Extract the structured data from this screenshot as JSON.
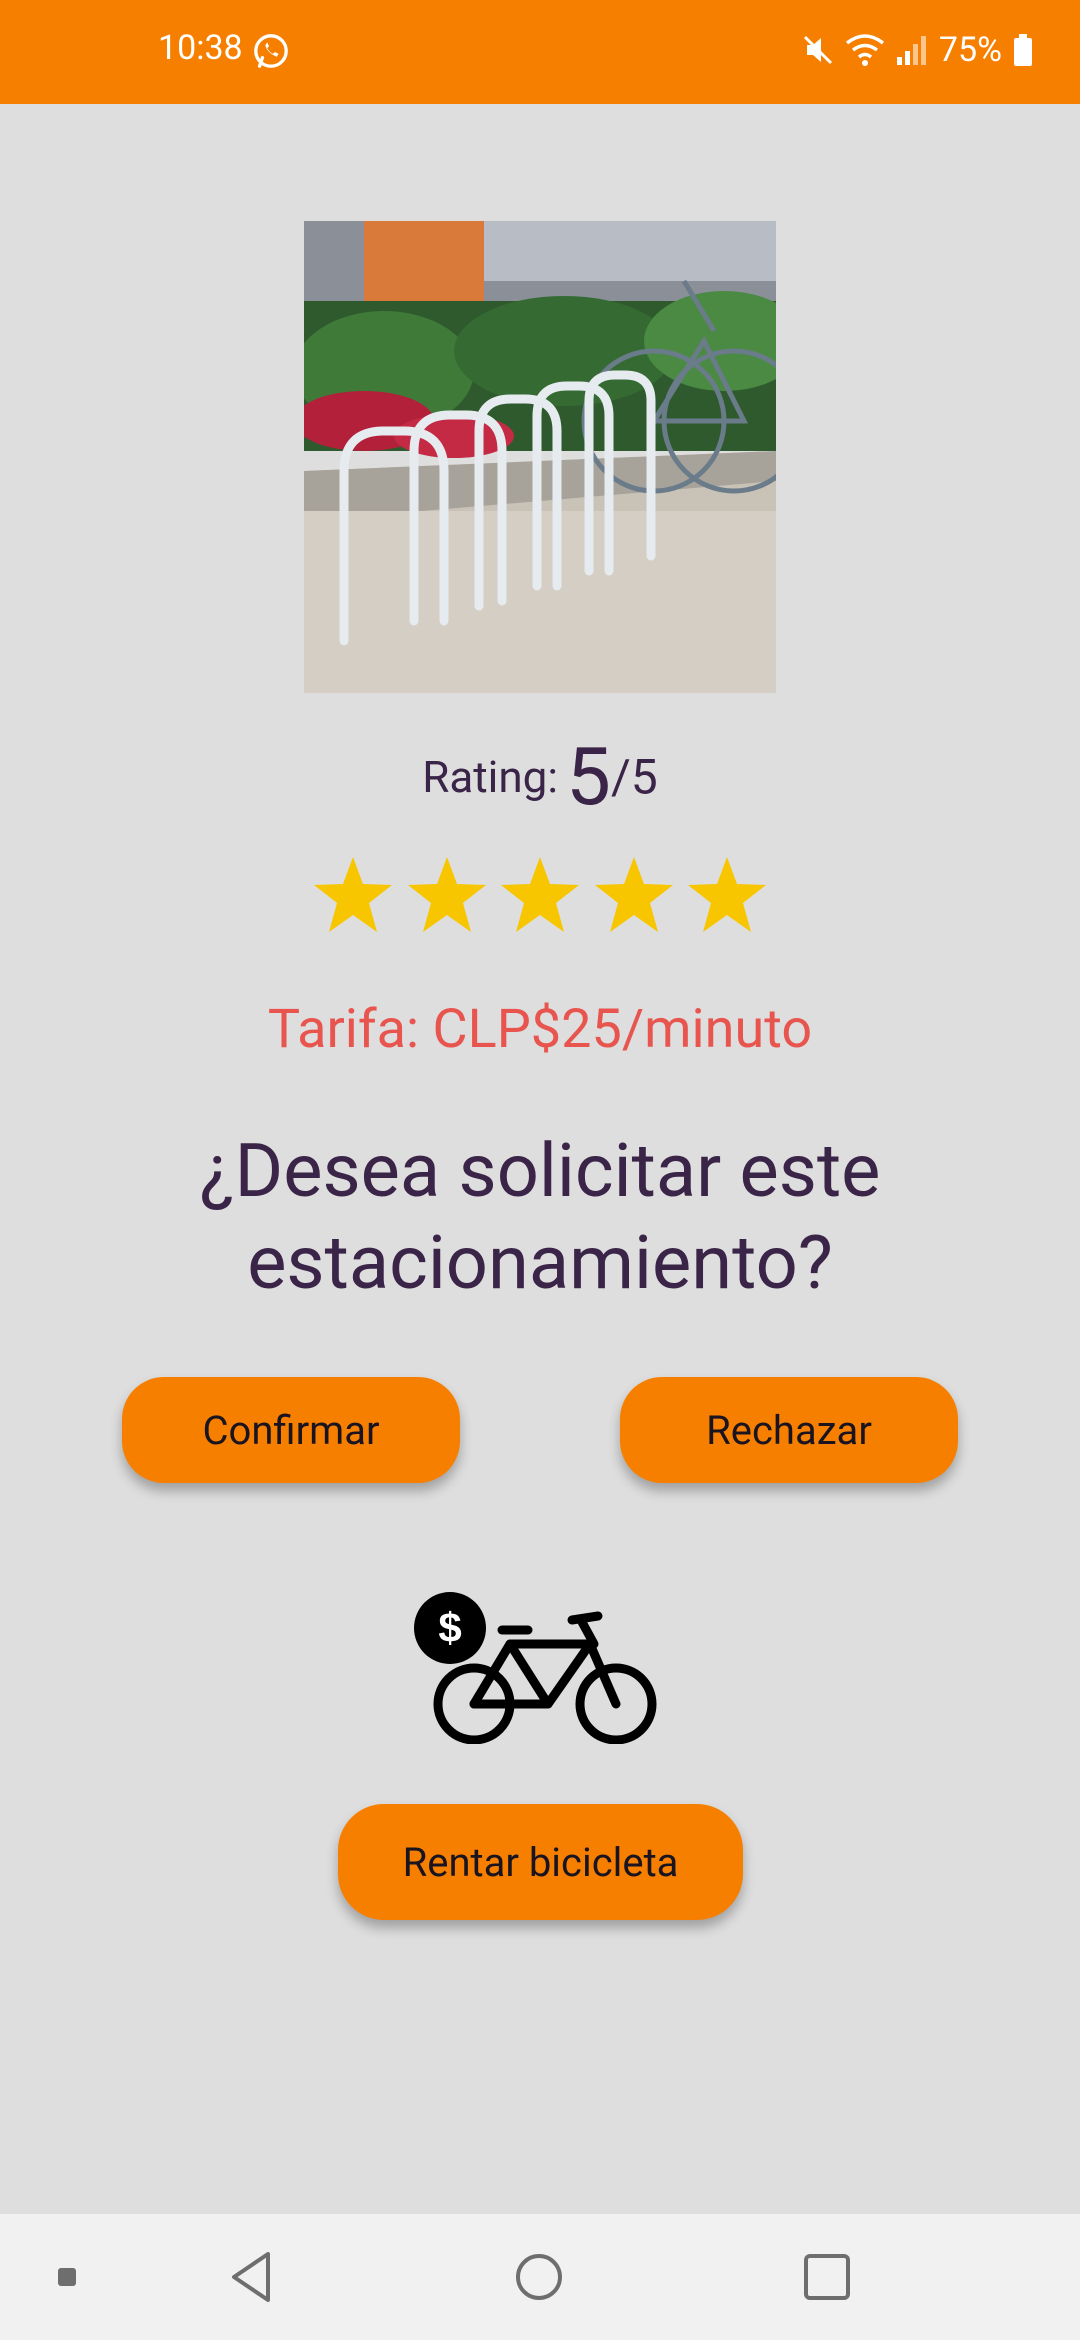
{
  "status_bar": {
    "time": "10:38",
    "battery": "75%",
    "icons": [
      "whatsapp-icon",
      "mute-icon",
      "wifi-icon",
      "signal-icon",
      "battery-icon"
    ]
  },
  "colors": {
    "accent": "#f77f00",
    "price": "#e8554e",
    "text": "#3a2447",
    "star": "#f7c600",
    "background": "#dedede"
  },
  "parking": {
    "image_icon": "bicycle-rack-photo",
    "rating_label": "Rating:",
    "rating_value": "5",
    "rating_max": "/5",
    "stars_filled": 5,
    "stars_total": 5,
    "tarifa": "Tarifa: CLP$25/minuto",
    "question": "¿Desea solicitar este estacionamiento?"
  },
  "actions": {
    "confirm_label": "Confirmar",
    "reject_label": "Rechazar",
    "rent_icon": "bike-rental-icon",
    "rent_label": "Rentar bicicleta"
  },
  "nav_bar": {
    "icons": [
      "nav-dot-icon",
      "back-icon",
      "home-icon",
      "recents-icon"
    ]
  }
}
